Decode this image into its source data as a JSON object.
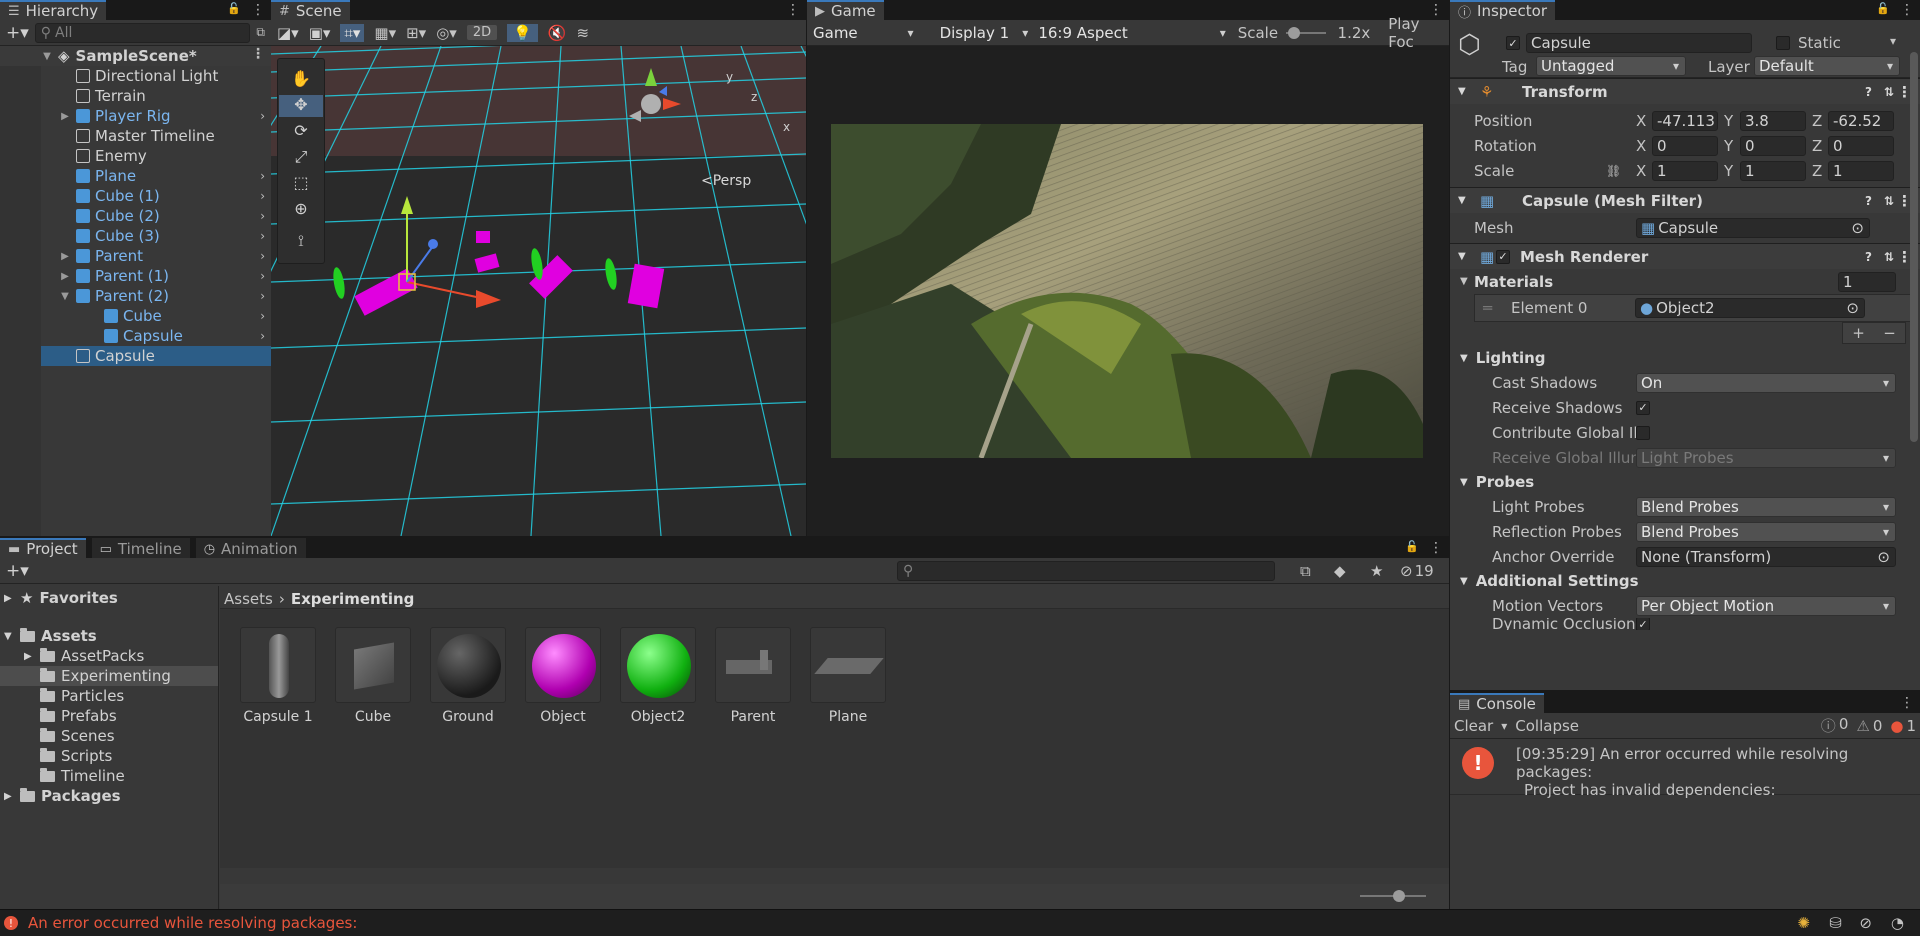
{
  "hierarchy": {
    "tab": "Hierarchy",
    "search_placeholder": "All",
    "scene": "SampleScene*",
    "items": [
      {
        "label": "Directional Light",
        "prefab": false,
        "depth": 1
      },
      {
        "label": "Terrain",
        "prefab": false,
        "depth": 1
      },
      {
        "label": "Player Rig",
        "prefab": true,
        "depth": 1
      },
      {
        "label": "Master Timeline",
        "prefab": false,
        "depth": 1
      },
      {
        "label": "Enemy",
        "prefab": false,
        "depth": 1
      },
      {
        "label": "Plane",
        "prefab": true,
        "depth": 1
      },
      {
        "label": "Cube (1)",
        "prefab": true,
        "depth": 1
      },
      {
        "label": "Cube (2)",
        "prefab": true,
        "depth": 1
      },
      {
        "label": "Cube (3)",
        "prefab": true,
        "depth": 1
      },
      {
        "label": "Parent",
        "prefab": true,
        "depth": 1
      },
      {
        "label": "Parent (1)",
        "prefab": true,
        "depth": 1
      },
      {
        "label": "Parent (2)",
        "prefab": true,
        "depth": 1
      },
      {
        "label": "Cube",
        "prefab": true,
        "depth": 2
      },
      {
        "label": "Capsule",
        "prefab": true,
        "depth": 2
      },
      {
        "label": "Capsule",
        "prefab": false,
        "depth": 1
      }
    ]
  },
  "scene": {
    "tab": "Scene",
    "btn_2d": "2D",
    "persp_label": "<Persp",
    "gizmo_y": "y",
    "gizmo_z": "z",
    "gizmo_x": "x"
  },
  "game": {
    "tab": "Game",
    "mode": "Game",
    "display": "Display 1",
    "aspect": "16:9 Aspect",
    "scale_label": "Scale",
    "scale_value": "1.2x",
    "play_focus": "Play Foc"
  },
  "inspector": {
    "tab": "Inspector",
    "object_name": "Capsule",
    "static_label": "Static",
    "tag_label": "Tag",
    "tag_value": "Untagged",
    "layer_label": "Layer",
    "layer_value": "Default",
    "transform": {
      "title": "Transform",
      "position_label": "Position",
      "rotation_label": "Rotation",
      "scale_label": "Scale",
      "position": {
        "x": "-47.113",
        "y": "3.8",
        "z": "-62.52"
      },
      "rotation": {
        "x": "0",
        "y": "0",
        "z": "0"
      },
      "scale": {
        "x": "1",
        "y": "1",
        "z": "1"
      },
      "x": "X",
      "y": "Y",
      "z": "Z"
    },
    "mesh_filter": {
      "title": "Capsule (Mesh Filter)",
      "mesh_label": "Mesh",
      "mesh_value": "Capsule"
    },
    "mesh_renderer": {
      "title": "Mesh Renderer",
      "materials_label": "Materials",
      "materials_count": "1",
      "element0_label": "Element 0",
      "element0_value": "Object2",
      "plus": "+",
      "minus": "−",
      "lighting": "Lighting",
      "cast_shadows_label": "Cast Shadows",
      "cast_shadows_value": "On",
      "receive_shadows_label": "Receive Shadows",
      "contribute_gi_label": "Contribute Global Ill",
      "receive_gi_label": "Receive Global Illun",
      "receive_gi_value": "Light Probes",
      "probes": "Probes",
      "light_probes_label": "Light Probes",
      "light_probes_value": "Blend Probes",
      "reflection_probes_label": "Reflection Probes",
      "reflection_probes_value": "Blend Probes",
      "anchor_label": "Anchor Override",
      "anchor_value": "None (Transform)",
      "additional": "Additional Settings",
      "motion_label": "Motion Vectors",
      "motion_value": "Per Object Motion",
      "dynamic_label": "Dynamic Occlusion"
    }
  },
  "console": {
    "tab": "Console",
    "clear": "Clear",
    "collapse": "Collapse",
    "info_count": "0",
    "warn_count": "0",
    "error_count": "1",
    "message_line1": "[09:35:29] An error occurred while resolving packages:",
    "message_line2": "Project has invalid dependencies:"
  },
  "project": {
    "tabs": [
      "Project",
      "Timeline",
      "Animation"
    ],
    "hidden_count": "19",
    "favorites": "Favorites",
    "assets": "Assets",
    "folders": [
      "AssetPacks",
      "Experimenting",
      "Particles",
      "Prefabs",
      "Scenes",
      "Scripts",
      "Timeline"
    ],
    "packages": "Packages",
    "breadcrumb_root": "Assets",
    "breadcrumb_current": "Experimenting",
    "items": [
      "Capsule 1",
      "Cube",
      "Ground",
      "Object",
      "Object2",
      "Parent",
      "Plane"
    ]
  },
  "status": {
    "message": "An error occurred while resolving packages:"
  },
  "colors": {
    "accent": "#3a79bb",
    "selection": "#2c5d87",
    "error": "#e8553c",
    "prefab": "#7bb6f0",
    "grid": "#23d3e6",
    "magenta": "#e000e0"
  }
}
